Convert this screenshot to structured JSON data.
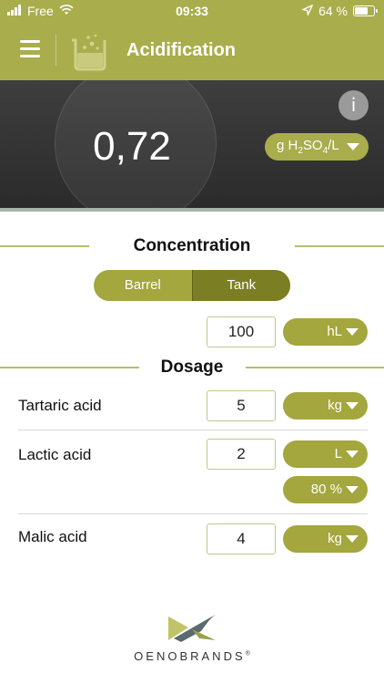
{
  "status_bar": {
    "carrier": "Free",
    "time": "09:33",
    "battery": "64 %",
    "battery_level": 0.64
  },
  "nav": {
    "title": "Acidification"
  },
  "result": {
    "value": "0,72",
    "unit_prefix": "g H",
    "unit_sub1": "2",
    "unit_mid": "SO",
    "unit_sub2": "4",
    "unit_suffix": "/L",
    "info_label": "i"
  },
  "concentration": {
    "title": "Concentration",
    "tabs": [
      "Barrel",
      "Tank"
    ],
    "selected_tab": "Tank",
    "volume": "100",
    "volume_unit": "hL"
  },
  "dosage": {
    "title": "Dosage",
    "rows": [
      {
        "label": "Tartaric acid",
        "value": "5",
        "unit": "kg"
      },
      {
        "label": "Lactic acid",
        "value": "2",
        "unit": "L",
        "extra": "80 %"
      },
      {
        "label": "Malic acid",
        "value": "4",
        "unit": "kg"
      }
    ]
  },
  "brand": {
    "name": "OENOBRANDS",
    "mark": "®"
  },
  "colors": {
    "accent": "#a9ad4c",
    "accent_dark": "#7b7e23",
    "hero_bg": "#333333"
  }
}
